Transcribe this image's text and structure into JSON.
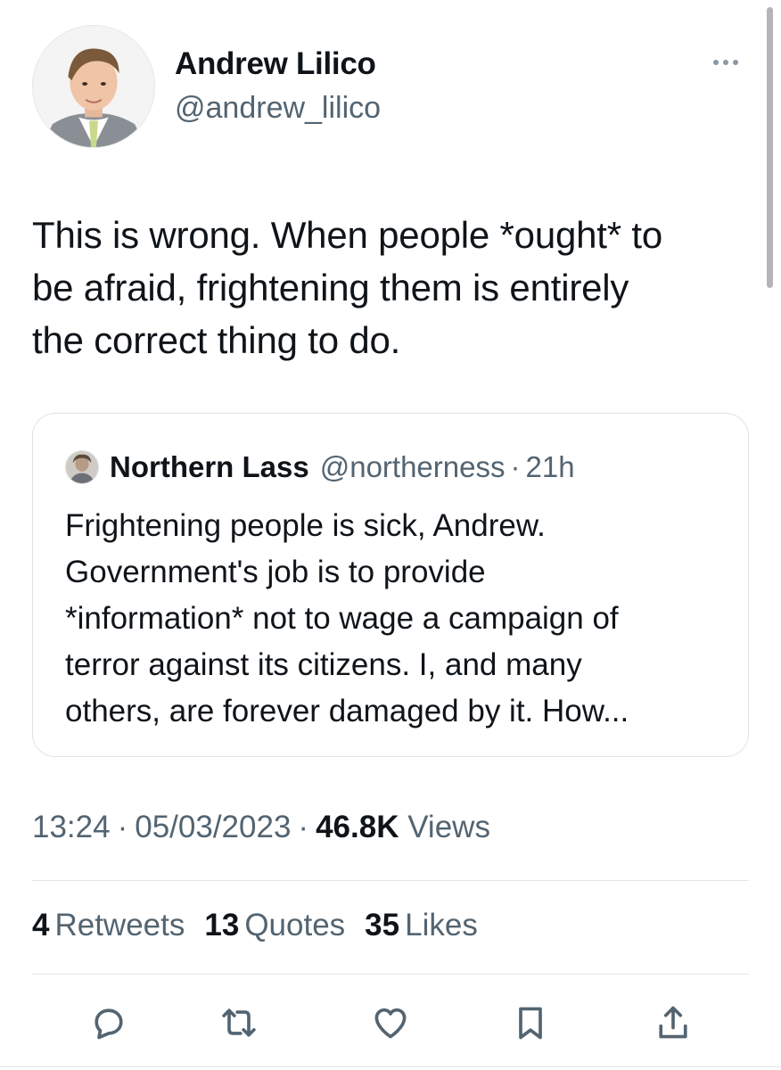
{
  "author": {
    "name": "Andrew Lilico",
    "handle": "@andrew_lilico"
  },
  "tweet": {
    "text": "This is wrong. When people *ought* to\nbe afraid, frightening them is entirely\nthe correct thing to do."
  },
  "quoted": {
    "name": "Northern Lass",
    "handle": "@northerness",
    "dot": "·",
    "time": "21h",
    "text": "Frightening people is sick, Andrew.\nGovernment's job is to provide\n*information* not to wage a campaign of\nterror against its citizens. I, and many\nothers, are forever damaged by it. How..."
  },
  "meta": {
    "time": "13:24",
    "dot": "·",
    "date": "05/03/2023",
    "views_count": "46.8K",
    "views_label": "Views"
  },
  "stats": [
    {
      "count": "4",
      "label": "Retweets"
    },
    {
      "count": "13",
      "label": "Quotes"
    },
    {
      "count": "35",
      "label": "Likes"
    }
  ],
  "icons": {
    "more": "more-icon",
    "reply": "reply-icon",
    "retweet": "retweet-icon",
    "like": "like-icon",
    "bookmark": "bookmark-icon",
    "share": "share-icon"
  },
  "colors": {
    "text": "#0f1419",
    "secondary": "#536471",
    "divider": "#e3e7ea"
  }
}
